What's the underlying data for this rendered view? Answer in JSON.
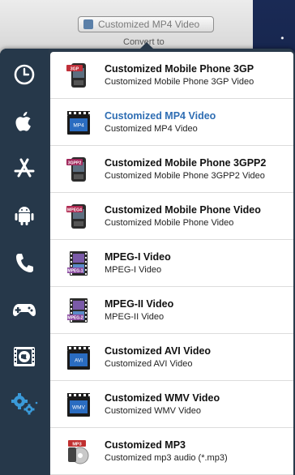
{
  "toolbar": {
    "format_value": "Customized MP4 Video",
    "convert_to_label": "Convert to"
  },
  "sidebar": {
    "items": [
      {
        "name": "recent",
        "icon": "clock-icon"
      },
      {
        "name": "apple",
        "icon": "apple-icon"
      },
      {
        "name": "app-store",
        "icon": "app-store-icon"
      },
      {
        "name": "android",
        "icon": "android-icon"
      },
      {
        "name": "phone",
        "icon": "phone-icon"
      },
      {
        "name": "game",
        "icon": "gamepad-icon"
      },
      {
        "name": "film",
        "icon": "film-globe-icon"
      },
      {
        "name": "custom",
        "icon": "gears-icon",
        "active": true
      }
    ]
  },
  "formats": [
    {
      "title": "Customized Mobile Phone 3GP",
      "subtitle": "Customized Mobile Phone 3GP Video",
      "badge": "3GP",
      "icon": "phone-3gp-icon",
      "color": "#c0303a"
    },
    {
      "title": "Customized MP4 Video",
      "subtitle": "Customized MP4 Video",
      "badge": "MP4",
      "icon": "clapper-mp4-icon",
      "color": "#2a6cc0",
      "selected": true
    },
    {
      "title": "Customized Mobile Phone 3GPP2",
      "subtitle": "Customized Mobile Phone 3GPP2 Video",
      "badge": "3GPP2",
      "icon": "phone-3gpp2-icon",
      "color": "#a0285c"
    },
    {
      "title": "Customized Mobile Phone Video",
      "subtitle": "Customized Mobile Phone Video",
      "badge": "MPEG4",
      "icon": "phone-mpeg4-icon",
      "color": "#b02850"
    },
    {
      "title": "MPEG-I Video",
      "subtitle": "MPEG-I Video",
      "badge": "MPEG-1",
      "icon": "film-mpeg1-icon",
      "color": "#8a4aa0"
    },
    {
      "title": "MPEG-II Video",
      "subtitle": "MPEG-II Video",
      "badge": "MPEG-2",
      "icon": "film-mpeg2-icon",
      "color": "#8a4aa0"
    },
    {
      "title": "Customized AVI Video",
      "subtitle": "Customized AVI Video",
      "badge": "AVI",
      "icon": "clapper-avi-icon",
      "color": "#2a6cc0"
    },
    {
      "title": "Customized WMV Video",
      "subtitle": "Customized WMV Video",
      "badge": "WMV",
      "icon": "clapper-wmv-icon",
      "color": "#2a6cc0"
    },
    {
      "title": "Customized MP3",
      "subtitle": "Customized mp3 audio (*.mp3)",
      "badge": "MP3",
      "icon": "mp3-audio-icon",
      "color": "#c03030"
    }
  ]
}
